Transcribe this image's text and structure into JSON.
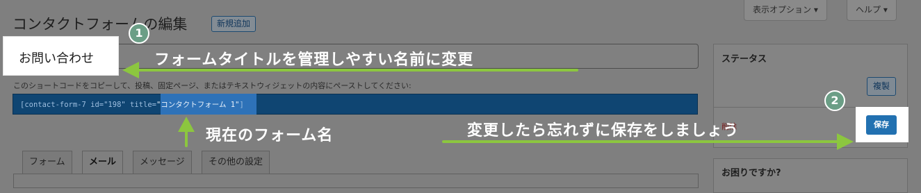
{
  "header": {
    "title": "コンタクトフォームの編集",
    "new_button": "新規追加",
    "screen_options": "表示オプション ▾",
    "help": "ヘルプ ▾"
  },
  "form": {
    "title_value": "お問い合わせ",
    "shortcode_hint": "このショートコードをコピーして、投稿、固定ページ、またはテキストウィジェットの内容にペーストしてください:",
    "shortcode_prefix": "[contact-form-7 id=\"198\" title=",
    "shortcode_title": "\"コンタクトフォーム 1\"",
    "shortcode_suffix": "]"
  },
  "tabs": [
    {
      "label": "フォーム",
      "active": false
    },
    {
      "label": "メール",
      "active": true
    },
    {
      "label": "メッセージ",
      "active": false
    },
    {
      "label": "その他の設定",
      "active": false
    }
  ],
  "sidebar": {
    "status_heading": "ステータス",
    "duplicate_button": "複製",
    "delete_link": "削除",
    "save_button": "保存",
    "help_heading": "お困りですか?"
  },
  "annotations": {
    "step1": "1",
    "step2": "2",
    "note_title": "フォームタイトルを管理しやすい名前に変更",
    "note_current": "現在のフォーム名",
    "note_save": "変更したら忘れずに保存をしましょう"
  },
  "colors": {
    "overlay": "#7f7f7f",
    "primary": "#2271b1",
    "shortcode_bg": "#0f4572",
    "arrow": "#8cc63f",
    "step_circle": "#6b9e86"
  }
}
